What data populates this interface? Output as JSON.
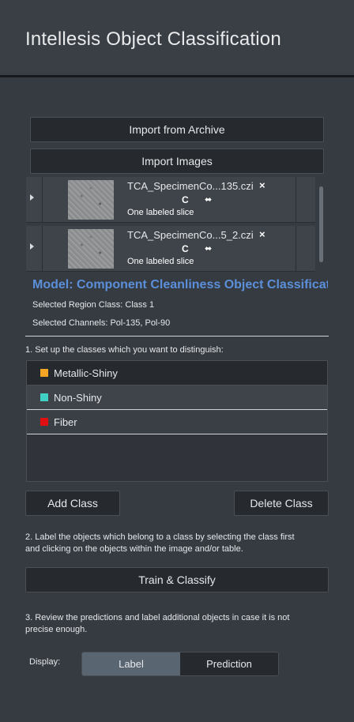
{
  "header": {
    "title": "Intellesis Object Classification"
  },
  "import": {
    "archive_label": "Import from Archive",
    "images_label": "Import Images"
  },
  "files": [
    {
      "name": "TCA_SpecimenCo...135.czi",
      "channel": "C",
      "swap": "⬌",
      "close": "×",
      "note": "One labeled slice"
    },
    {
      "name": "TCA_SpecimenCo...5_2.czi",
      "channel": "C",
      "swap": "⬌",
      "close": "×",
      "note": "One labeled slice"
    }
  ],
  "model": {
    "text": "Model:  Component Cleanliness Object Classificatio"
  },
  "selection": {
    "region_class": "Selected Region Class: Class 1",
    "channels": "Selected Channels: Pol-135, Pol-90"
  },
  "step1": {
    "text": "1. Set up the classes which you want to distinguish:"
  },
  "classes": [
    {
      "name": "Metallic-Shiny",
      "color": "#f5a623"
    },
    {
      "name": "Non-Shiny",
      "color": "#3fd1c4"
    },
    {
      "name": "Fiber",
      "color": "#e01010"
    }
  ],
  "class_buttons": {
    "add_label": "Add Class",
    "delete_label": "Delete Class"
  },
  "step2": {
    "line1": "2. Label the objects which belong to a class by selecting the class first",
    "line2": "and clicking on the objects within the image and/or table."
  },
  "train": {
    "label": "Train & Classify"
  },
  "step3": {
    "line1": "3. Review the predictions and label additional objects in case it is not",
    "line2": "precise enough."
  },
  "display": {
    "label": "Display:",
    "options": [
      "Label",
      "Prediction"
    ],
    "selected": "Label"
  }
}
